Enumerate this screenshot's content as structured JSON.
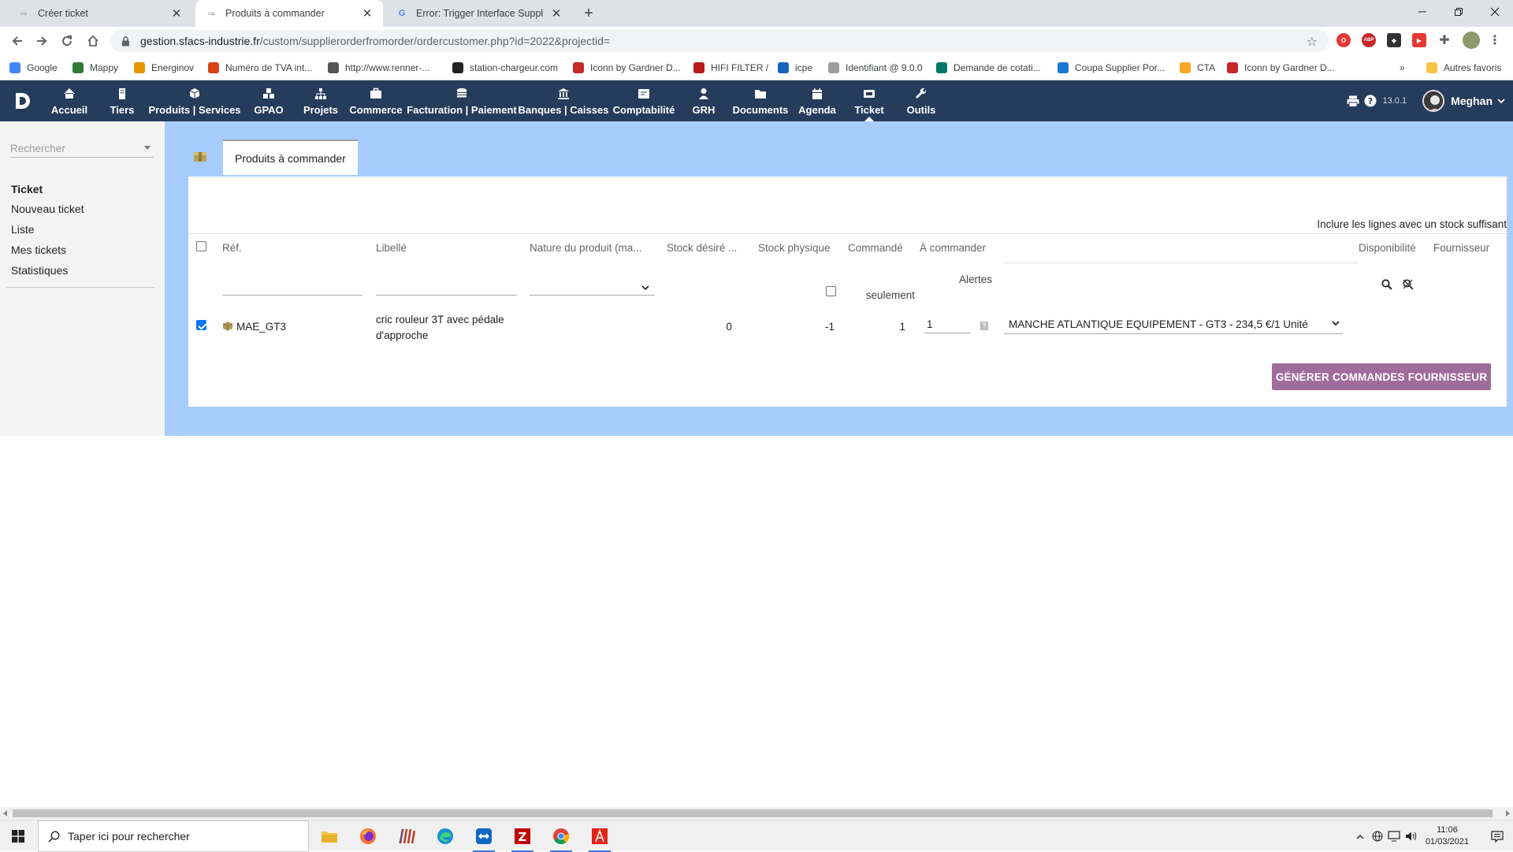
{
  "browser": {
    "tabs": [
      {
        "title": "Créer ticket",
        "active": false
      },
      {
        "title": "Produits à commander",
        "active": true
      },
      {
        "title": "Error: Trigger Interface Supplier c",
        "active": false
      }
    ],
    "url_host": "gestion.sfacs-industrie.fr",
    "url_path": "/custom/supplierorderfromorder/ordercustomer.php?id=2022&projectid=",
    "bookmarks": [
      {
        "label": "Google",
        "icon": "google-icon",
        "color": "#4285f4"
      },
      {
        "label": "Mappy",
        "icon": "mappy-icon",
        "color": "#2e7d32"
      },
      {
        "label": "Energinov",
        "icon": "energinov-icon",
        "color": "#e69500"
      },
      {
        "label": "Numéro de TVA int...",
        "icon": "tva-icon",
        "color": "#d84315"
      },
      {
        "label": "http://www.renner-...",
        "icon": "globe-icon",
        "color": "#555555"
      },
      {
        "label": "station-chargeur.com",
        "icon": "station-icon",
        "color": "#222222"
      },
      {
        "label": "Iconn by Gardner D...",
        "icon": "iconn-icon",
        "color": "#c62828"
      },
      {
        "label": "HIFI FILTER /",
        "icon": "hifi-icon",
        "color": "#b71c1c"
      },
      {
        "label": "icpe",
        "icon": "flag-icon",
        "color": "#1565c0"
      },
      {
        "label": "Identifiant @ 9.0.0",
        "icon": "identifiant-icon",
        "color": "#9e9e9e"
      },
      {
        "label": "Demande de cotati...",
        "icon": "forms-icon",
        "color": "#00796b"
      },
      {
        "label": "Coupa Supplier Por...",
        "icon": "coupa-icon",
        "color": "#1976d2"
      },
      {
        "label": "CTA",
        "icon": "cart-icon",
        "color": "#f9a825"
      },
      {
        "label": "Iconn by Gardner D...",
        "icon": "iconn-icon",
        "color": "#c62828"
      }
    ],
    "other_bookmarks": "Autres favoris",
    "more_bookmarks": "»"
  },
  "app": {
    "menu": [
      {
        "label": "Accueil",
        "icon": "home-icon"
      },
      {
        "label": "Tiers",
        "icon": "building-icon"
      },
      {
        "label": "Produits | Services",
        "icon": "cube-icon"
      },
      {
        "label": "GPAO",
        "icon": "cubes-icon"
      },
      {
        "label": "Projets",
        "icon": "sitemap-icon"
      },
      {
        "label": "Commerce",
        "icon": "briefcase-icon"
      },
      {
        "label": "Facturation | Paiement",
        "icon": "coins-icon"
      },
      {
        "label": "Banques | Caisses",
        "icon": "bank-icon"
      },
      {
        "label": "Comptabilité",
        "icon": "ledger-icon"
      },
      {
        "label": "GRH",
        "icon": "user-icon"
      },
      {
        "label": "Documents",
        "icon": "folder-icon"
      },
      {
        "label": "Agenda",
        "icon": "calendar-icon"
      },
      {
        "label": "Ticket",
        "icon": "ticket-icon"
      },
      {
        "label": "Outils",
        "icon": "wrench-icon"
      }
    ],
    "active_menu": "Ticket",
    "version": "13.0.1",
    "user": "Meghan",
    "colors": {
      "header_bg": "#263c5c",
      "main_bg": "#a8cdfd",
      "button_bg": "#a06c9c"
    }
  },
  "sidebar": {
    "search_placeholder": "Rechercher",
    "title": "Ticket",
    "items": [
      "Nouveau ticket",
      "Liste",
      "Mes tickets",
      "Statistiques"
    ]
  },
  "page": {
    "tab_label": "Produits à commander",
    "include_label": "Inclure les lignes avec un stock suffisant",
    "columns": [
      "Réf.",
      "Libellé",
      "Nature du produit (ma...",
      "Stock désiré ...",
      "Stock physique",
      "Commandé",
      "À commander",
      "Disponibilité",
      "Fournisseur"
    ],
    "alerts_label_line1": "Alertes",
    "alerts_label_line2": "seulement",
    "rows": [
      {
        "checked": true,
        "ref": "MAE_GT3",
        "label_line1": "cric rouleur 3T avec pédale",
        "label_line2": "d'approche",
        "stock_desired": "0",
        "stock_physical": "-1",
        "ordered": "1",
        "to_order": "1",
        "supplier": "MANCHE ATLANTIQUE EQUIPEMENT - GT3 - 234,5 €/1 Unité"
      }
    ],
    "generate_button": "GÉNÉRER COMMANDES FOURNISSEUR"
  },
  "taskbar": {
    "search_placeholder": "Taper ici pour rechercher",
    "apps": [
      "file-explorer-icon",
      "firefox-icon",
      "winrar-icon",
      "edge-icon",
      "teamviewer-icon",
      "filezilla-icon",
      "chrome-icon",
      "acrobat-icon"
    ],
    "time": "11:06",
    "date": "01/03/2021"
  }
}
